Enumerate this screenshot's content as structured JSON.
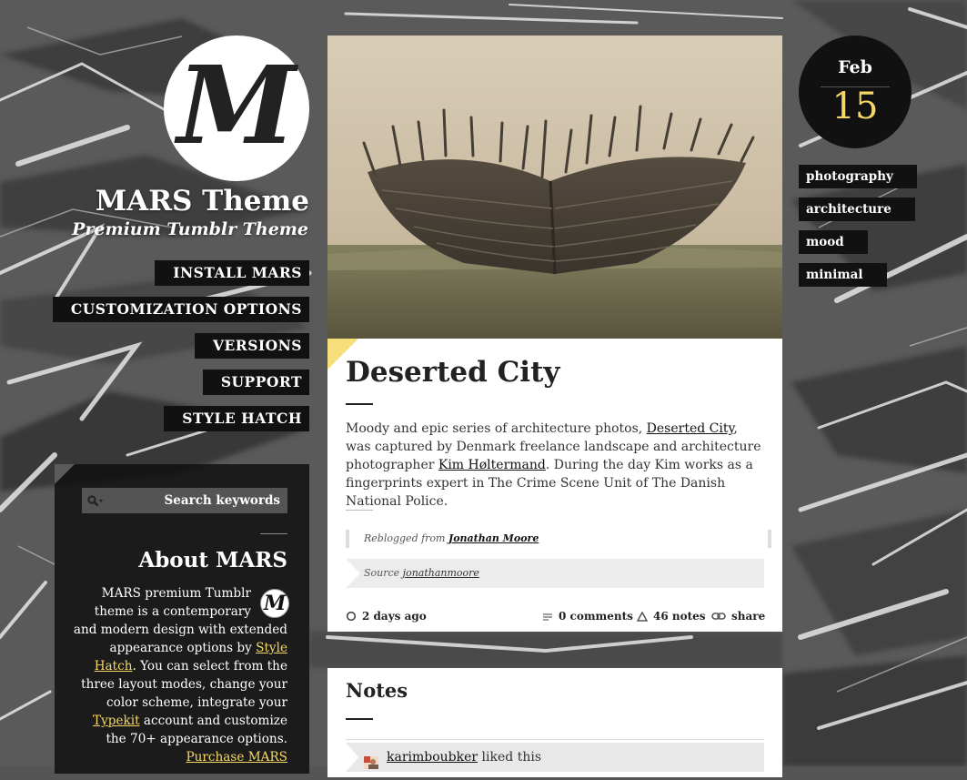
{
  "site": {
    "logo_letter": "M",
    "title": "MARS Theme",
    "subtitle": "Premium Tumblr Theme"
  },
  "nav": {
    "items": [
      "INSTALL MARS",
      "CUSTOMIZATION OPTIONS",
      "VERSIONS",
      "SUPPORT",
      "STYLE HATCH"
    ]
  },
  "sidebar": {
    "search_placeholder": "Search keywords",
    "about_title": "About MARS",
    "thumb_letter": "M",
    "about_text_1": "MARS premium Tumblr theme is a contemporary and modern design with extended appearance options by ",
    "link_style_hatch": "Style Hatch",
    "about_text_2": ". You can select from the three layout modes, change your color scheme, integrate your ",
    "link_typekit": "Typekit",
    "about_text_3": " account and customize the 70+ appearance options. ",
    "link_purchase": "Purchase MARS"
  },
  "post": {
    "title": "Deserted City",
    "body_1": "Moody and epic series of architecture photos, ",
    "body_link_1": "Deserted City",
    "body_2": ", was captured by Denmark freelance landscape and architecture photographer ",
    "body_link_2": "Kim Høltermand",
    "body_3": ". During the day Kim works as a fingerprints expert in The Crime Scene Unit of The Danish National Police.",
    "reblogged_label": "Reblogged from ",
    "reblogged_from": "Jonathan Moore",
    "source_label": "Source ",
    "source_link": "jonathanmoore",
    "meta": {
      "time": "2 days ago",
      "comments": "0 comments",
      "notes": "46 notes",
      "share": "share"
    }
  },
  "notes": {
    "title": "Notes",
    "first_user": "karimboubker",
    "first_action": " liked this"
  },
  "date": {
    "month": "Feb",
    "day": "15"
  },
  "tags": [
    "photography",
    "architecture",
    "mood",
    "minimal"
  ],
  "colors": {
    "accent_yellow": "#f6d866",
    "flag_yellow": "#f6df7b",
    "dark": "#111111"
  }
}
